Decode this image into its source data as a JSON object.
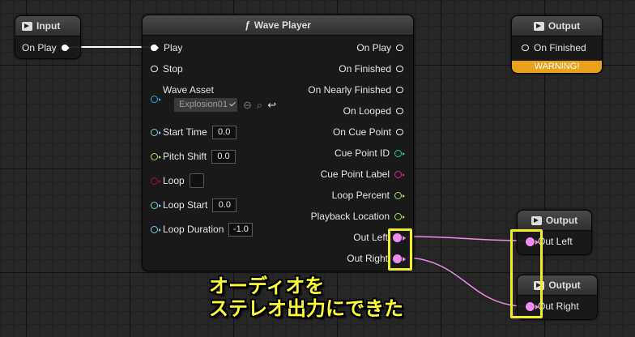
{
  "input_node": {
    "title": "Input",
    "pin_label": "On Play"
  },
  "wave_player": {
    "title": "Wave Player",
    "title_glyph": "ƒ",
    "inputs": {
      "play": "Play",
      "stop": "Stop",
      "wave_asset": "Wave Asset",
      "wave_asset_value": "Explosion01",
      "start_time": "Start Time",
      "start_time_value": "0.0",
      "pitch_shift": "Pitch Shift",
      "pitch_shift_value": "0.0",
      "loop": "Loop",
      "loop_start": "Loop Start",
      "loop_start_value": "0.0",
      "loop_duration": "Loop Duration",
      "loop_duration_value": "-1.0"
    },
    "outputs": {
      "on_play": "On Play",
      "on_finished": "On Finished",
      "on_nearly_finished": "On Nearly Finished",
      "on_looped": "On Looped",
      "on_cue_point": "On Cue Point",
      "cue_point_id": "Cue Point ID",
      "cue_point_label": "Cue Point Label",
      "loop_percent": "Loop Percent",
      "playback_location": "Playback Location",
      "out_left": "Out Left",
      "out_right": "Out Right"
    }
  },
  "output_finished": {
    "title": "Output",
    "pin_label": "On Finished",
    "warning": "WARNING!"
  },
  "output_left": {
    "title": "Output",
    "pin_label": "Out Left"
  },
  "output_right": {
    "title": "Output",
    "pin_label": "Out Right"
  },
  "caption": {
    "line1": "オーディオを",
    "line2": "ステレオ出力にできた"
  },
  "colors": {
    "audio_wire": "#ee8cee",
    "exec_wire": "#ffffff",
    "highlight": "#f2ee24",
    "warning": "#e8a11a",
    "float_pin": "#a6e36b",
    "time_pin": "#6ad6dc",
    "bool_pin": "#a01616",
    "string_pin": "#e61ea0"
  }
}
